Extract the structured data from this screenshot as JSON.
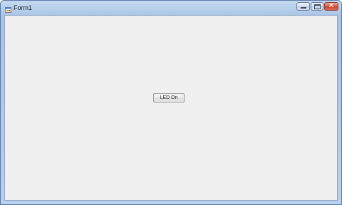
{
  "window": {
    "title": "Form1",
    "icon": "winforms-app-icon",
    "caption_buttons": {
      "minimize_icon": "minimize-icon",
      "maximize_icon": "maximize-icon",
      "close_icon": "close-icon",
      "close_glyph": "✕"
    }
  },
  "form": {
    "led_button_label": "LED On"
  },
  "colors": {
    "client_background": "#f0f0f0",
    "titlebar": "#b9d0ee",
    "close_button": "#c8412a"
  }
}
